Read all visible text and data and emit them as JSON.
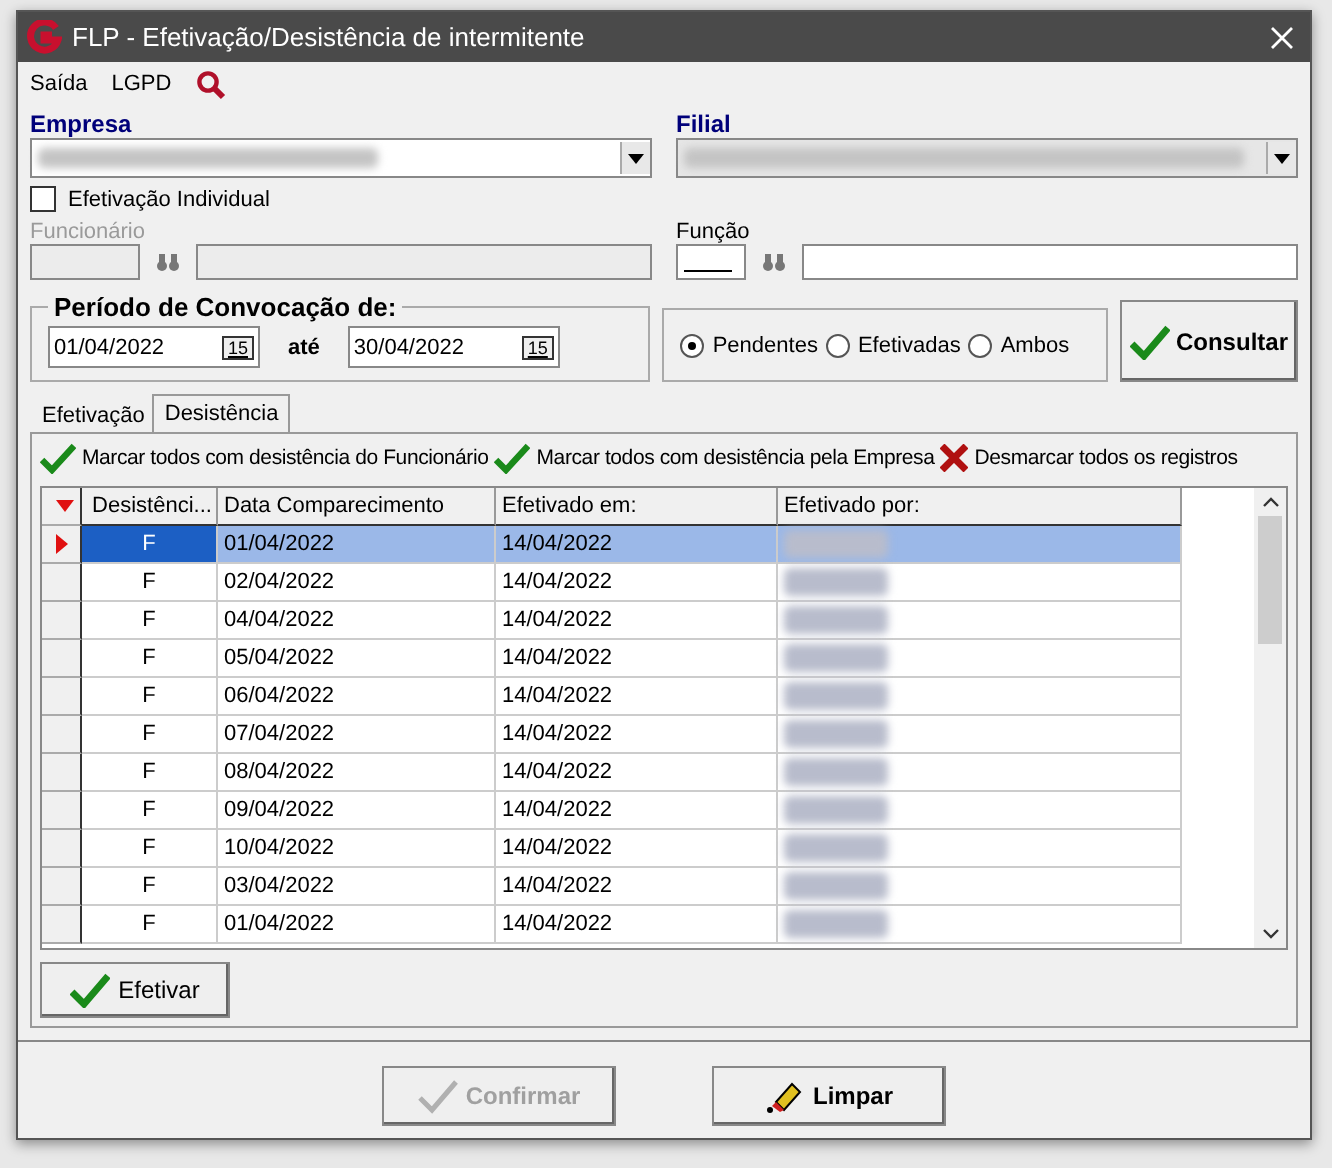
{
  "window": {
    "title": "FLP - Efetivação/Desistência de intermitente"
  },
  "menu": [
    {
      "label": "Saída"
    },
    {
      "label": "LGPD"
    }
  ],
  "empresa": {
    "label": "Empresa"
  },
  "filial": {
    "label": "Filial"
  },
  "individual": {
    "label": "Efetivação Individual",
    "checked": false
  },
  "funcionario": {
    "label": "Funcionário",
    "disabled": true
  },
  "funcao": {
    "label": "Função",
    "disabled": false
  },
  "periodo": {
    "legend": "Período de Convocação de:",
    "from": "01/04/2022",
    "separator": "até",
    "to": "30/04/2022",
    "calendar_glyph_from": "15",
    "calendar_glyph_to": "15"
  },
  "status_options": [
    {
      "label": "Pendentes",
      "selected": true
    },
    {
      "label": "Efetivadas",
      "selected": false
    },
    {
      "label": "Ambos",
      "selected": false
    }
  ],
  "consultar": {
    "label": "Consultar"
  },
  "tabs": [
    {
      "label": "Efetivação",
      "selected": false
    },
    {
      "label": "Desistência",
      "selected": true
    }
  ],
  "actions": [
    {
      "label": "Marcar todos com desistência do Funcionário",
      "kind": "check"
    },
    {
      "label": "Marcar todos com desistência pela Empresa",
      "kind": "check"
    },
    {
      "label": "Desmarcar todos os registros",
      "kind": "cross"
    }
  ],
  "table": {
    "columns": [
      "Desistênci...",
      "Data Comparecimento",
      "Efetivado em:",
      "Efetivado por:"
    ],
    "rows": [
      {
        "cells": [
          "F",
          "01/04/2022",
          "14/04/2022"
        ],
        "selected": true
      },
      {
        "cells": [
          "F",
          "02/04/2022",
          "14/04/2022"
        ],
        "selected": false
      },
      {
        "cells": [
          "F",
          "04/04/2022",
          "14/04/2022"
        ],
        "selected": false
      },
      {
        "cells": [
          "F",
          "05/04/2022",
          "14/04/2022"
        ],
        "selected": false
      },
      {
        "cells": [
          "F",
          "06/04/2022",
          "14/04/2022"
        ],
        "selected": false
      },
      {
        "cells": [
          "F",
          "07/04/2022",
          "14/04/2022"
        ],
        "selected": false
      },
      {
        "cells": [
          "F",
          "08/04/2022",
          "14/04/2022"
        ],
        "selected": false
      },
      {
        "cells": [
          "F",
          "09/04/2022",
          "14/04/2022"
        ],
        "selected": false
      },
      {
        "cells": [
          "F",
          "10/04/2022",
          "14/04/2022"
        ],
        "selected": false
      },
      {
        "cells": [
          "F",
          "03/04/2022",
          "14/04/2022"
        ],
        "selected": false
      },
      {
        "cells": [
          "F",
          "01/04/2022",
          "14/04/2022"
        ],
        "selected": false
      }
    ]
  },
  "efetivar": {
    "label": "Efetivar"
  },
  "footer_buttons": [
    {
      "label": "Confirmar",
      "kind": "check",
      "disabled": true
    },
    {
      "label": "Limpar",
      "kind": "eraser",
      "disabled": false
    }
  ]
}
